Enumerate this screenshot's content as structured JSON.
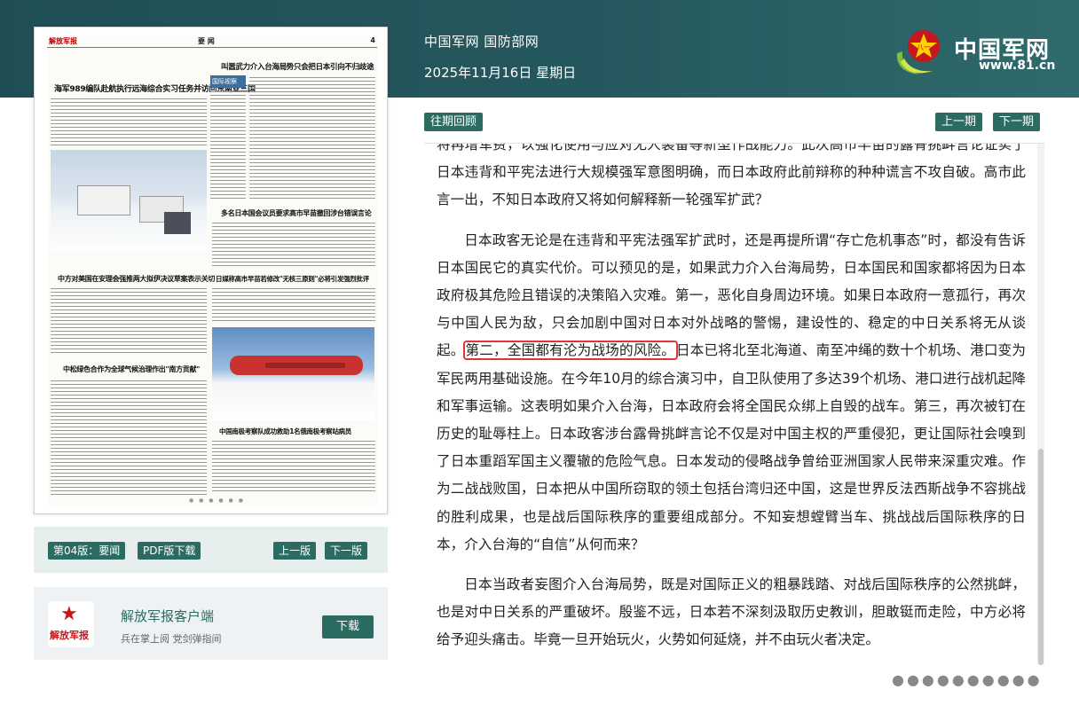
{
  "header": {
    "site_names": "中国军网 国防部网",
    "date": "2025年11月16日 星期日",
    "logo_name": "中国军网",
    "logo_url": "www.81.cn",
    "logo_icon": "army-star-emblem-icon"
  },
  "newspaper": {
    "masthead": "解放军报",
    "page_header": "要 闻",
    "page_number": "4",
    "headlines": [
      "海军989编队赴航执行远海综合实习任务并访问东南亚三国",
      "叫嚣武力介入台海局势只会把日本引向不归歧途",
      "国际视察",
      "多名日本国会议员要求高市早苗撤回涉台错误言论",
      "日媒称高市早苗若修改\"无核三原则\"必将引发强烈批评",
      "中方对美国在安理会强推两大拟伊决议草案表示关切",
      "中松绿色合作为全球气候治理作出\"南方贡献\"",
      "中国南极考察队成功救助1名俄南极考察站病员"
    ]
  },
  "edition_bar": {
    "edition_label": "第04版：要闻",
    "pdf_label": "PDF版下载",
    "prev_edition": "上一版",
    "next_edition": "下一版"
  },
  "app_promo": {
    "logo_text": "解放军报",
    "title": "解放军报客户端",
    "subtitle": "兵在掌上阅 党剑弹指间",
    "download": "下载"
  },
  "toolbar": {
    "archive": "往期回顾",
    "prev_issue": "上一期",
    "next_issue": "下一期"
  },
  "article": {
    "p1": "将再增军费，以强化使用与应对无人装备等新型作战能力。此次高市早苗的露骨挑衅言论证实了日本违背和平宪法进行大规模强军意图明确，而日本政府此前辩称的种种谎言不攻自破。高市此言一出，不知日本政府又将如何解释新一轮强军扩武？",
    "p2_a": "日本政客无论是在违背和平宪法强军扩武时，还是再提所谓“存亡危机事态”时，都没有告诉日本国民它的真实代价。可以预见的是，如果武力介入台海局势，日本国民和国家都将因为日本政府极其危险且错误的决策陷入灾难。第一，恶化自身周边环境。如果日本政府一意孤行，再次与中国人民为敌，只会加剧中国对日本对外战略的警惕，建设性的、稳定的中日关系将无从谈起。",
    "p2_hl": "第二，全国都有沦为战场的风险。",
    "p2_b": "日本已将北至北海道、南至冲绳的数十个机场、港口变为军民两用基础设施。在今年10月的综合演习中，自卫队使用了多达39个机场、港口进行战机起降和军事运输。这表明如果介入台海，日本政府会将全国民众绑上自毁的战车。第三，再次被钉在历史的耻辱柱上。日本政客涉台露骨挑衅言论不仅是对中国主权的严重侵犯，更让国际社会嗅到了日本重蹈军国主义覆辙的危险气息。日本发动的侵略战争曾给亚洲国家人民带来深重灾难。作为二战战败国，日本把从中国所窃取的领土包括台湾归还中国，这是世界反法西斯战争不容挑战的胜利成果，也是战后国际秩序的重要组成部分。不知妄想螳臂当车、挑战战后国际秩序的日本，介入台海的“自信”从何而来？",
    "p3": "日本当政者妄图介入台海局势，既是对国际正义的粗暴践踏、对战后国际秩序的公然挑衅，也是对中日关系的严重破坏。殷鉴不远，日本若不深刻汲取历史教训，胆敢铤而走险，中方必将给予迎头痛击。毕竟一旦开始玩火，火势如何延烧，并不由玩火者决定。"
  },
  "colors": {
    "header_bg": "#1f4f55",
    "button_bg": "#2b6b62",
    "highlight_border": "#e0333a"
  }
}
